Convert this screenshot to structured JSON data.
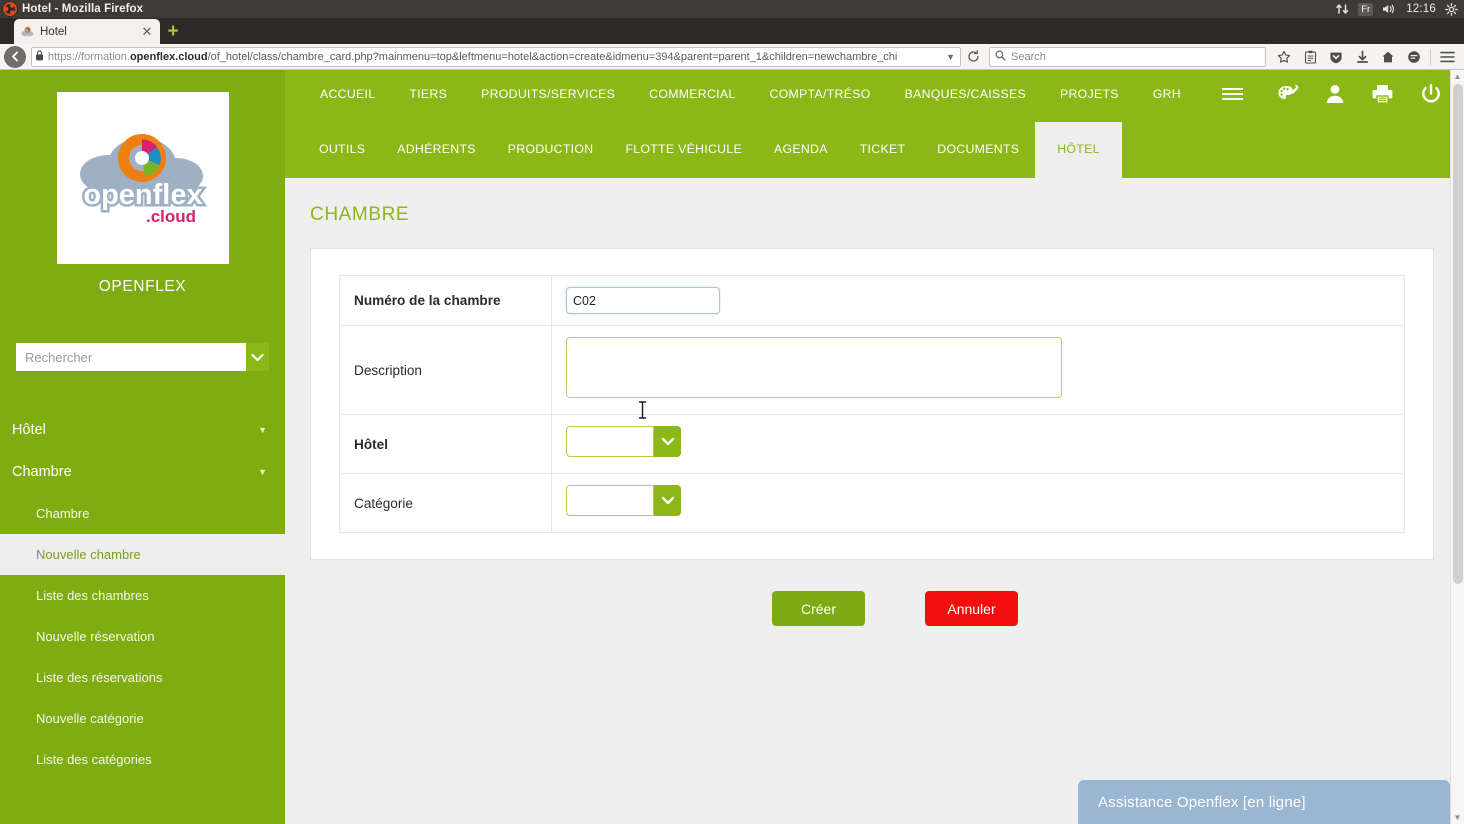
{
  "os": {
    "window_title": "Hotel - Mozilla Firefox",
    "tray": {
      "network_icon": "network-updown-icon",
      "keyboard_layout": "Fr",
      "volume_icon": "volume-icon",
      "time": "12:16",
      "settings_icon": "gear-icon"
    }
  },
  "browser": {
    "tab": {
      "title": "Hotel",
      "favicon": "openflex-cloud-favicon",
      "close_icon": "close-icon"
    },
    "new_tab_label": "+",
    "back_icon": "back-arrow-icon",
    "lock_icon": "padlock-icon",
    "url": {
      "scheme": "https://",
      "host_prefix": "formation.",
      "host_bold": "openflex.cloud",
      "path": "/of_hotel/class/chambre_card.php?mainmenu=top&leftmenu=hotel&action=create&idmenu=394&parent=parent_1&children=newchambre_chi",
      "dropdown_icon": "chevron-down-icon",
      "reload_icon": "reload-icon"
    },
    "search": {
      "placeholder": "Search",
      "icon": "search-icon"
    },
    "toolbar_icons": [
      "star-bookmark-icon",
      "reader-list-icon",
      "pocket-shield-icon",
      "download-arrow-icon",
      "home-icon",
      "chat-bubble-icon",
      "hamburger-menu-icon"
    ]
  },
  "sidebar": {
    "logo_alt": "openflex.cloud",
    "brand": "OPENFLEX",
    "search": {
      "placeholder": "Rechercher",
      "go_icon": "chevron-down-icon"
    },
    "groups": [
      {
        "label": "Hôtel",
        "caret": "▾"
      },
      {
        "label": "Chambre",
        "caret": "▾"
      }
    ],
    "items": [
      {
        "label": "Chambre",
        "active": false
      },
      {
        "label": "Nouvelle chambre",
        "active": true
      },
      {
        "label": "Liste des chambres",
        "active": false
      },
      {
        "label": "Nouvelle réservation",
        "active": false
      },
      {
        "label": "Liste des réservations",
        "active": false
      },
      {
        "label": "Nouvelle catégorie",
        "active": false
      },
      {
        "label": "Liste des catégories",
        "active": false
      }
    ]
  },
  "topnav": {
    "row1": [
      "ACCUEIL",
      "TIERS",
      "PRODUITS/SERVICES",
      "COMMERCIAL",
      "COMPTA/TRÉSO",
      "BANQUES/CAISSES",
      "PROJETS",
      "GRH"
    ],
    "burger_icon": "hamburger-menu-icon",
    "icons": [
      "palette-brush-icon",
      "user-icon",
      "printer-icon",
      "power-icon"
    ],
    "row2": [
      {
        "label": "OUTILS",
        "active": false
      },
      {
        "label": "ADHÉRENTS",
        "active": false
      },
      {
        "label": "PRODUCTION",
        "active": false
      },
      {
        "label": "FLOTTE VÉHICULE",
        "active": false
      },
      {
        "label": "AGENDA",
        "active": false
      },
      {
        "label": "TICKET",
        "active": false
      },
      {
        "label": "DOCUMENTS",
        "active": false
      },
      {
        "label": "HÔTEL",
        "active": true
      }
    ]
  },
  "main": {
    "title": "CHAMBRE",
    "fields": [
      {
        "label": "Numéro de la chambre",
        "bold": true,
        "type": "text",
        "value": "C02"
      },
      {
        "label": "Description",
        "bold": false,
        "type": "textarea",
        "value": ""
      },
      {
        "label": "Hôtel",
        "bold": true,
        "type": "select",
        "value": ""
      },
      {
        "label": "Catégorie",
        "bold": false,
        "type": "select",
        "value": ""
      }
    ],
    "buttons": {
      "create": "Créer",
      "cancel": "Annuler"
    },
    "create_color": "#7dab14",
    "cancel_color": "#f40f0f"
  },
  "assistance": {
    "label": "Assistance Openflex [en ligne]",
    "color": "#9bb6d0"
  },
  "theme": {
    "green": "#8cb817",
    "sidebar_green": "#7fac10",
    "active_tab_bg": "#eeeeee"
  }
}
